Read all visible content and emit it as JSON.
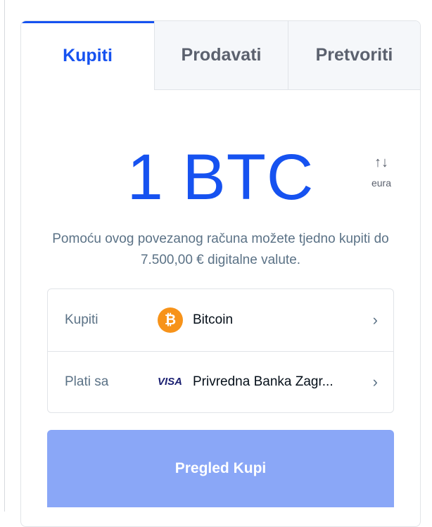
{
  "tabs": [
    {
      "label": "Kupiti",
      "active": true
    },
    {
      "label": "Prodavati",
      "active": false
    },
    {
      "label": "Pretvoriti",
      "active": false
    }
  ],
  "amount": {
    "display": "1 BTC",
    "toggle_icon": "swap-arrows-icon",
    "toggle_label": "eura"
  },
  "limit_text": "Pomoću ovog povezanog računa možete tjedno kupiti do 7.500,00 € digitalne valute.",
  "rows": [
    {
      "label": "Kupiti",
      "icon": "bitcoin-icon",
      "icon_glyph": "₿",
      "value": "Bitcoin"
    },
    {
      "label": "Plati sa",
      "icon": "visa-icon",
      "icon_glyph": "VISA",
      "value": "Privredna Banka Zagr..."
    }
  ],
  "review_button": "Pregled Kupi",
  "colors": {
    "accent": "#1652f0",
    "button_disabled": "#8aa7f7",
    "bitcoin": "#f7931a",
    "muted_text": "#5b7286"
  }
}
